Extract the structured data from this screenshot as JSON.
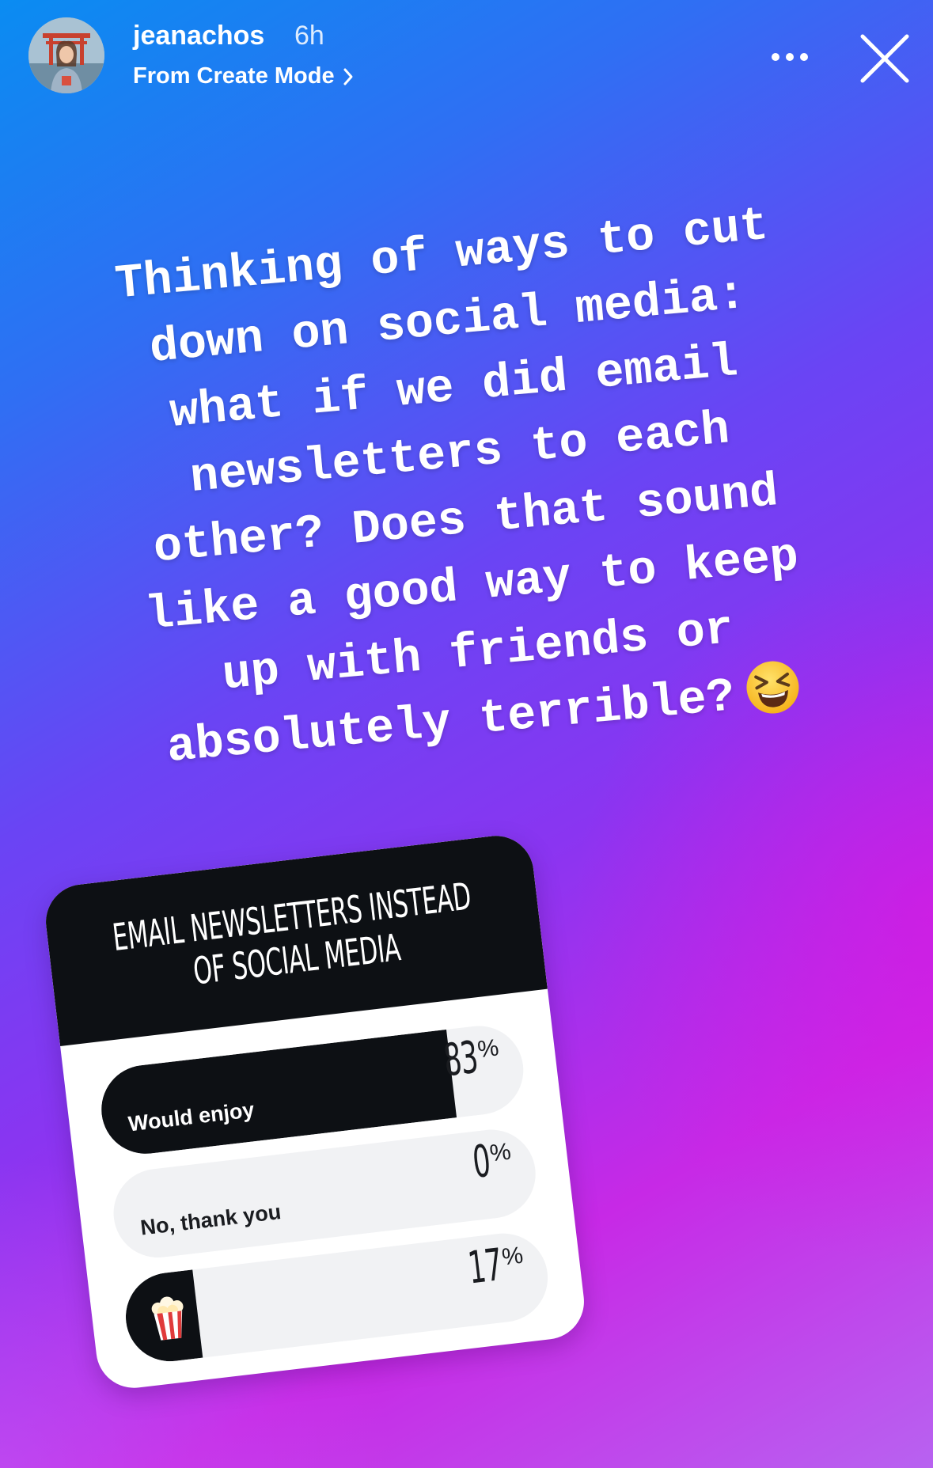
{
  "header": {
    "username": "jeanachos",
    "time": "6h",
    "subtitle": "From Create Mode",
    "more_icon": "more-dots-icon",
    "close_icon": "close-x-icon"
  },
  "caption": {
    "text": "Thinking of ways to cut down on social media: what if we did email newsletters to each other? Does that sound like a good way to keep up with friends or absolutely terrible?",
    "lines": [
      "Thinking of ways to cut",
      "down on social media:",
      "what if we did email",
      "newsletters to each",
      "other? Does that sound",
      "like a good way to keep",
      "up with friends or",
      "absolutely terrible?"
    ],
    "emoji": "grinning-squinting-face-emoji"
  },
  "poll": {
    "question_line1": "EMAIL NEWSLETTERS INSTEAD",
    "question_line2": "OF SOCIAL MEDIA",
    "options": [
      {
        "label": "Would enjoy",
        "percent": "83",
        "fill_fraction": 0.83
      },
      {
        "label": "No, thank you",
        "percent": "0",
        "fill_fraction": 0
      },
      {
        "label": "",
        "icon": "popcorn-icon",
        "percent": "17",
        "fill_fraction": 0.17
      }
    ],
    "percent_sign": "%"
  },
  "colors": {
    "gradient_top": "#0a8cf2",
    "gradient_mid": "#8a35f1",
    "gradient_bottom": "#c729e6",
    "poll_dark": "#0d1014",
    "poll_track": "#f1f2f4"
  }
}
